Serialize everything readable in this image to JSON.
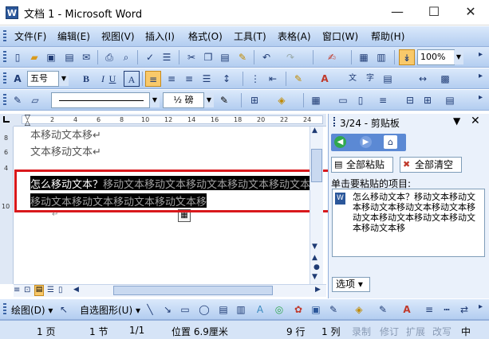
{
  "window": {
    "title": "文档 1 - Microsoft Word",
    "icon": "W",
    "minimize_icon": "—",
    "maximize_icon": "☐",
    "close_icon": "✕"
  },
  "menu": [
    "文件(F)",
    "编辑(E)",
    "视图(V)",
    "插入(I)",
    "格式(O)",
    "工具(T)",
    "表格(A)",
    "窗口(W)",
    "帮助(H)"
  ],
  "toolbar": {
    "zoom": "100%",
    "style_icon": "A",
    "font_size": "五号",
    "bold": "B",
    "italic": "I",
    "underline": "U",
    "char_border": "A",
    "font_color_letter": "A",
    "line_weight": "½ 磅"
  },
  "ruler": {
    "h_ticks": [
      "2",
      "4",
      "6",
      "8",
      "10",
      "12",
      "14",
      "16",
      "18",
      "20",
      "22",
      "24"
    ],
    "v_ticks": [
      "8",
      "6",
      "4",
      "10"
    ]
  },
  "document": {
    "line1": "本移动文本移↵",
    "line2": "文本移动文本↵",
    "selected_head": "怎么移动文本？",
    "selected_tail": "移动文本移动文本移动文本移动文本移动文本移动",
    "selected_line2": "移动文本移动文本移动文本移动文本移",
    "pilcrow": "↵",
    "paste_icon": "📋"
  },
  "panel": {
    "header": "3/24 - 剪贴板",
    "paste_all": "全部粘贴",
    "clear_all": "全部清空",
    "prompt": "单击要粘贴的项目:",
    "clip_item": "怎么移动文本？移动文本移动文本移动文本移动文本移动文本移动文本移动文本移动文本移动文本移动文本移",
    "options": "选项 ▾"
  },
  "drawbar": {
    "draw": "绘图(D) ▾",
    "autoshape": "自选图形(U) ▾"
  },
  "status": {
    "page": "1 页",
    "section": "1 节",
    "pages": "1/1",
    "position": "位置 6.9厘米",
    "line": "9 行",
    "col": "1 列",
    "rec": "录制",
    "trk": "修订",
    "ext": "扩展",
    "ovr": "改写",
    "lang": "中"
  },
  "colors": {
    "highlight_red": "#d9181c",
    "selection_bg": "#000000",
    "selected_gray": "#a0a0a0",
    "accent_blue": "#2b579a"
  }
}
